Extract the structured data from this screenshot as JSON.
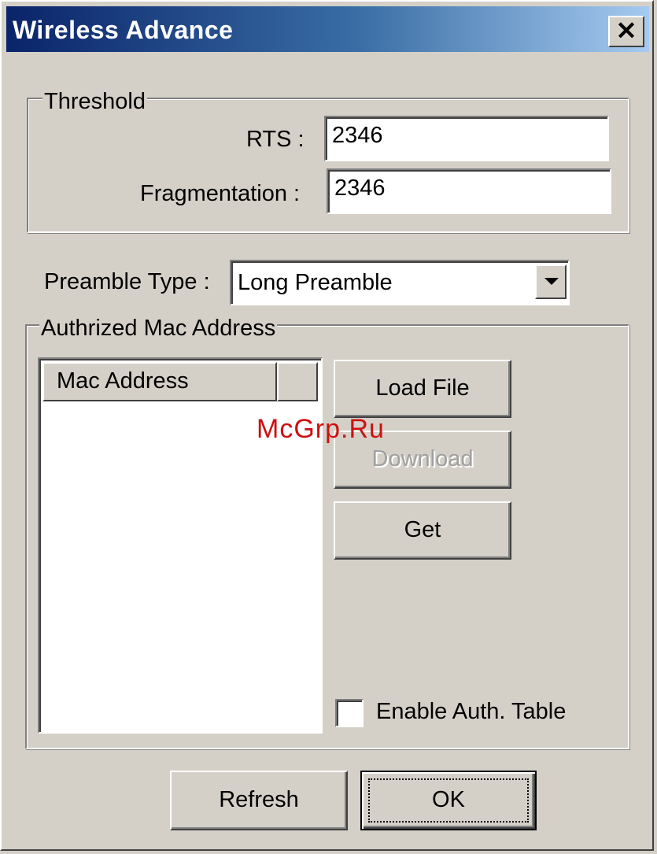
{
  "window": {
    "title": "Wireless Advance",
    "close_glyph": "✕",
    "close_icon": "close-icon"
  },
  "threshold": {
    "group_label": "Threshold",
    "rts_label": "RTS :",
    "rts_value": "2346",
    "fragmentation_label": "Fragmentation :",
    "fragmentation_value": "2346"
  },
  "preamble": {
    "label": "Preamble Type :",
    "selected": "Long Preamble",
    "arrow_icon": "chevron-down-icon"
  },
  "auth_mac": {
    "group_label": "Authrized Mac Address",
    "list": {
      "columns": [
        "Mac Address",
        ""
      ],
      "rows": []
    },
    "buttons": {
      "load_file": "Load File",
      "download": "Download",
      "get": "Get"
    },
    "enable_auth_table": {
      "label": "Enable Auth. Table",
      "checked": false
    }
  },
  "footer": {
    "refresh": "Refresh",
    "ok": "OK"
  },
  "watermark": "McGrp.Ru",
  "colors": {
    "title_gradient_start": "#0a246a",
    "title_gradient_end": "#a6caf0",
    "face": "#d4d0c8",
    "watermark": "#cc1111"
  }
}
